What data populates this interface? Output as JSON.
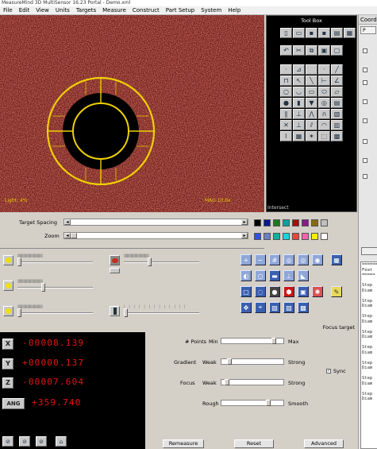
{
  "window": {
    "title": "MeasureMind 3D MultiSensor 16.23 Portal - Demo.xml"
  },
  "menu": [
    "File",
    "Edit",
    "View",
    "Units",
    "Targets",
    "Measure",
    "Construct",
    "Part Setup",
    "System",
    "Help"
  ],
  "camera": {
    "light_label": "Light: 4%",
    "mag_label": "MAG 10.0x",
    "ring_color": "#f0d000"
  },
  "toolbox": {
    "title": "Tool Box",
    "footer": "Intersect"
  },
  "target_spacing": {
    "label": "Target Spacing"
  },
  "zoom": {
    "label": "Zoom"
  },
  "swatches": {
    "row1": [
      "#000000",
      "#0a1a8a",
      "#1a7a1a",
      "#0fa0a0",
      "#a01010",
      "#8a1a8a",
      "#8a6a10",
      "#c0c0c0"
    ],
    "row2": [
      "#3050e0",
      "#6a80c0",
      "#10b0a0",
      "#20d0e0",
      "#f04040",
      "#ff60b0",
      "#f8f000",
      "#ffffff"
    ]
  },
  "focus_target": "Focus target",
  "dro": {
    "x": {
      "label": "X",
      "value": "-00008.139"
    },
    "y": {
      "label": "Y",
      "value": "+00000.137"
    },
    "z": {
      "label": "Z",
      "value": "-00007.604"
    },
    "ang": {
      "label": "ANG",
      "value": "+359.740"
    },
    "value_color": "#e81414"
  },
  "params": {
    "points": {
      "label": "# Points",
      "min": "Min",
      "max": "Max",
      "level": 0.88
    },
    "gradient": {
      "label": "Gradient",
      "low": "Weak",
      "high": "Strong",
      "level": 0.1
    },
    "focus": {
      "label": "Focus",
      "low": "Weak",
      "high": "Strong",
      "level": 0.05
    },
    "rough": {
      "label": "Rough",
      "high": "Smooth",
      "level": 0.78
    },
    "sync": {
      "label": "Sync",
      "checked": true
    },
    "buttons": {
      "remeasure": "Remeasure",
      "reset": "Reset",
      "advanced": "Advanced"
    }
  },
  "right_panel": {
    "title": "Coord",
    "tab": "P",
    "log": [
      "======",
      "Feat",
      "=====",
      "",
      "Step",
      "Diam",
      "",
      "Step",
      "Diam",
      "",
      "Step",
      "Diam",
      "",
      "Step",
      "Diam",
      "",
      "Step",
      "Diam",
      "",
      "Step",
      "Diam",
      "",
      "Step",
      "Diam",
      "",
      "Step",
      "Diam"
    ]
  }
}
